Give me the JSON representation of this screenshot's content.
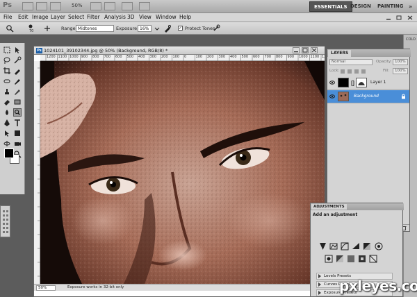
{
  "app": {
    "logo": "Ps",
    "zoom": "50%",
    "workspaces": [
      "ESSENTIALS",
      "DESIGN",
      "PAINTING",
      "»"
    ]
  },
  "menu": [
    "File",
    "Edit",
    "Image",
    "Layer",
    "Select",
    "Filter",
    "Analysis",
    "3D",
    "View",
    "Window",
    "Help"
  ],
  "options": {
    "brush_size": "70",
    "range_label": "Range:",
    "range_value": "Midtones",
    "exposure_label": "Exposure:",
    "exposure_value": "16%",
    "protect_tones_label": "Protect Tones",
    "protect_tones_checked": true
  },
  "document": {
    "title": "1024101_39102344.jpg @ 50% (Background, RGB/8) *",
    "ruler_ticks": [
      "1200",
      "1100",
      "1000",
      "900",
      "800",
      "700",
      "600",
      "500",
      "400",
      "300",
      "200",
      "100",
      "0",
      "100",
      "200",
      "300",
      "400",
      "500",
      "600",
      "700",
      "800",
      "900",
      "1000",
      "1100",
      "1200"
    ],
    "status_zoom": "50%",
    "status_text": "Exposure works in 32-bit only"
  },
  "layers": {
    "tab": "LAYERS",
    "blend_mode": "Normal",
    "opacity_label": "Opacity:",
    "opacity_value": "100%",
    "lock_label": "Lock:",
    "fill_label": "Fill:",
    "fill_value": "100%",
    "items": [
      {
        "name": "Layer 1",
        "selected": false
      },
      {
        "name": "Background",
        "selected": true
      }
    ]
  },
  "adjustments": {
    "tab": "ADJUSTMENTS",
    "heading": "Add an adjustment",
    "presets": [
      "Levels Presets",
      "Curves Presets",
      "Exposure Presets"
    ]
  },
  "dock": {
    "color_tab": "COLO"
  },
  "watermark": {
    "text": "pxleyes.com",
    "mark": "™"
  }
}
